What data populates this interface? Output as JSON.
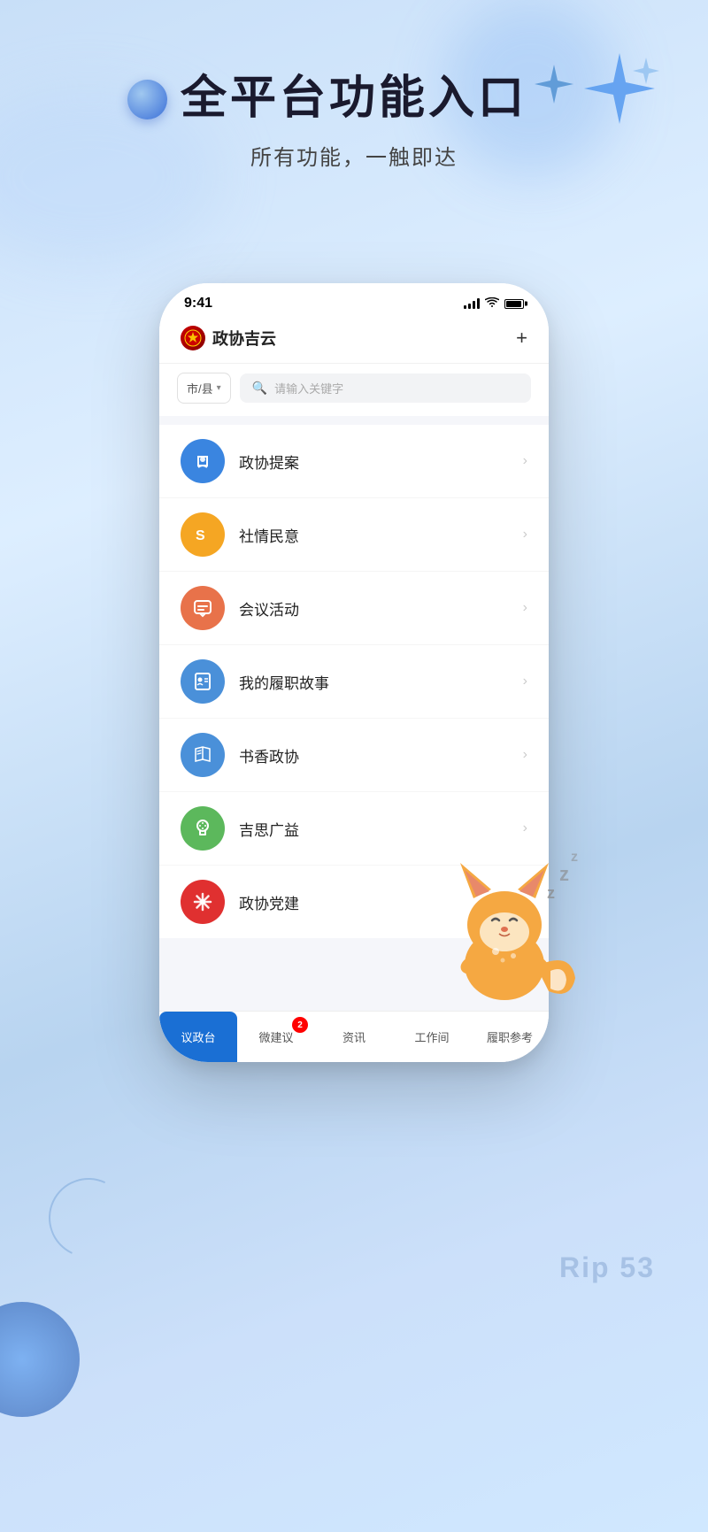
{
  "background": {
    "gradient_start": "#c8dff8",
    "gradient_end": "#d0e8ff"
  },
  "hero": {
    "title": "全平台功能入口",
    "subtitle": "所有功能，一触即达"
  },
  "phone": {
    "status_bar": {
      "time": "9:41",
      "signal": "●●●●",
      "battery_level": 100
    },
    "header": {
      "app_name": "政协吉云",
      "plus_label": "+"
    },
    "search": {
      "location_label": "市/县",
      "search_placeholder": "请输入关键字"
    },
    "menu_items": [
      {
        "id": "proposal",
        "label": "政协提案",
        "icon_bg": "#3a85e0",
        "icon_char": "🔍"
      },
      {
        "id": "public_opinion",
        "label": "社情民意",
        "icon_bg": "#f5a623",
        "icon_char": "S"
      },
      {
        "id": "meeting",
        "label": "会议活动",
        "icon_bg": "#e8724a",
        "icon_char": "💬"
      },
      {
        "id": "duty_story",
        "label": "我的履职故事",
        "icon_bg": "#4a90d9",
        "icon_char": "👤"
      },
      {
        "id": "book_xiezhi",
        "label": "书香政协",
        "icon_bg": "#4a90d9",
        "icon_char": "📖"
      },
      {
        "id": "jisi_guangyi",
        "label": "吉思广益",
        "icon_bg": "#5cb85c",
        "icon_char": "💡"
      },
      {
        "id": "party_building",
        "label": "政协党建",
        "icon_bg": "#e03030",
        "icon_char": "☭"
      }
    ],
    "tabs": [
      {
        "id": "yizheng",
        "label": "议政台",
        "active": true,
        "badge": null
      },
      {
        "id": "weijianyi",
        "label": "微建议",
        "active": false,
        "badge": "2"
      },
      {
        "id": "zixun",
        "label": "资讯",
        "active": false,
        "badge": null
      },
      {
        "id": "gongjian",
        "label": "工作间",
        "active": false,
        "badge": null
      },
      {
        "id": "lvzhi",
        "label": "履职参考",
        "active": false,
        "badge": null
      }
    ]
  },
  "rip53": {
    "text": "Rip 53"
  }
}
